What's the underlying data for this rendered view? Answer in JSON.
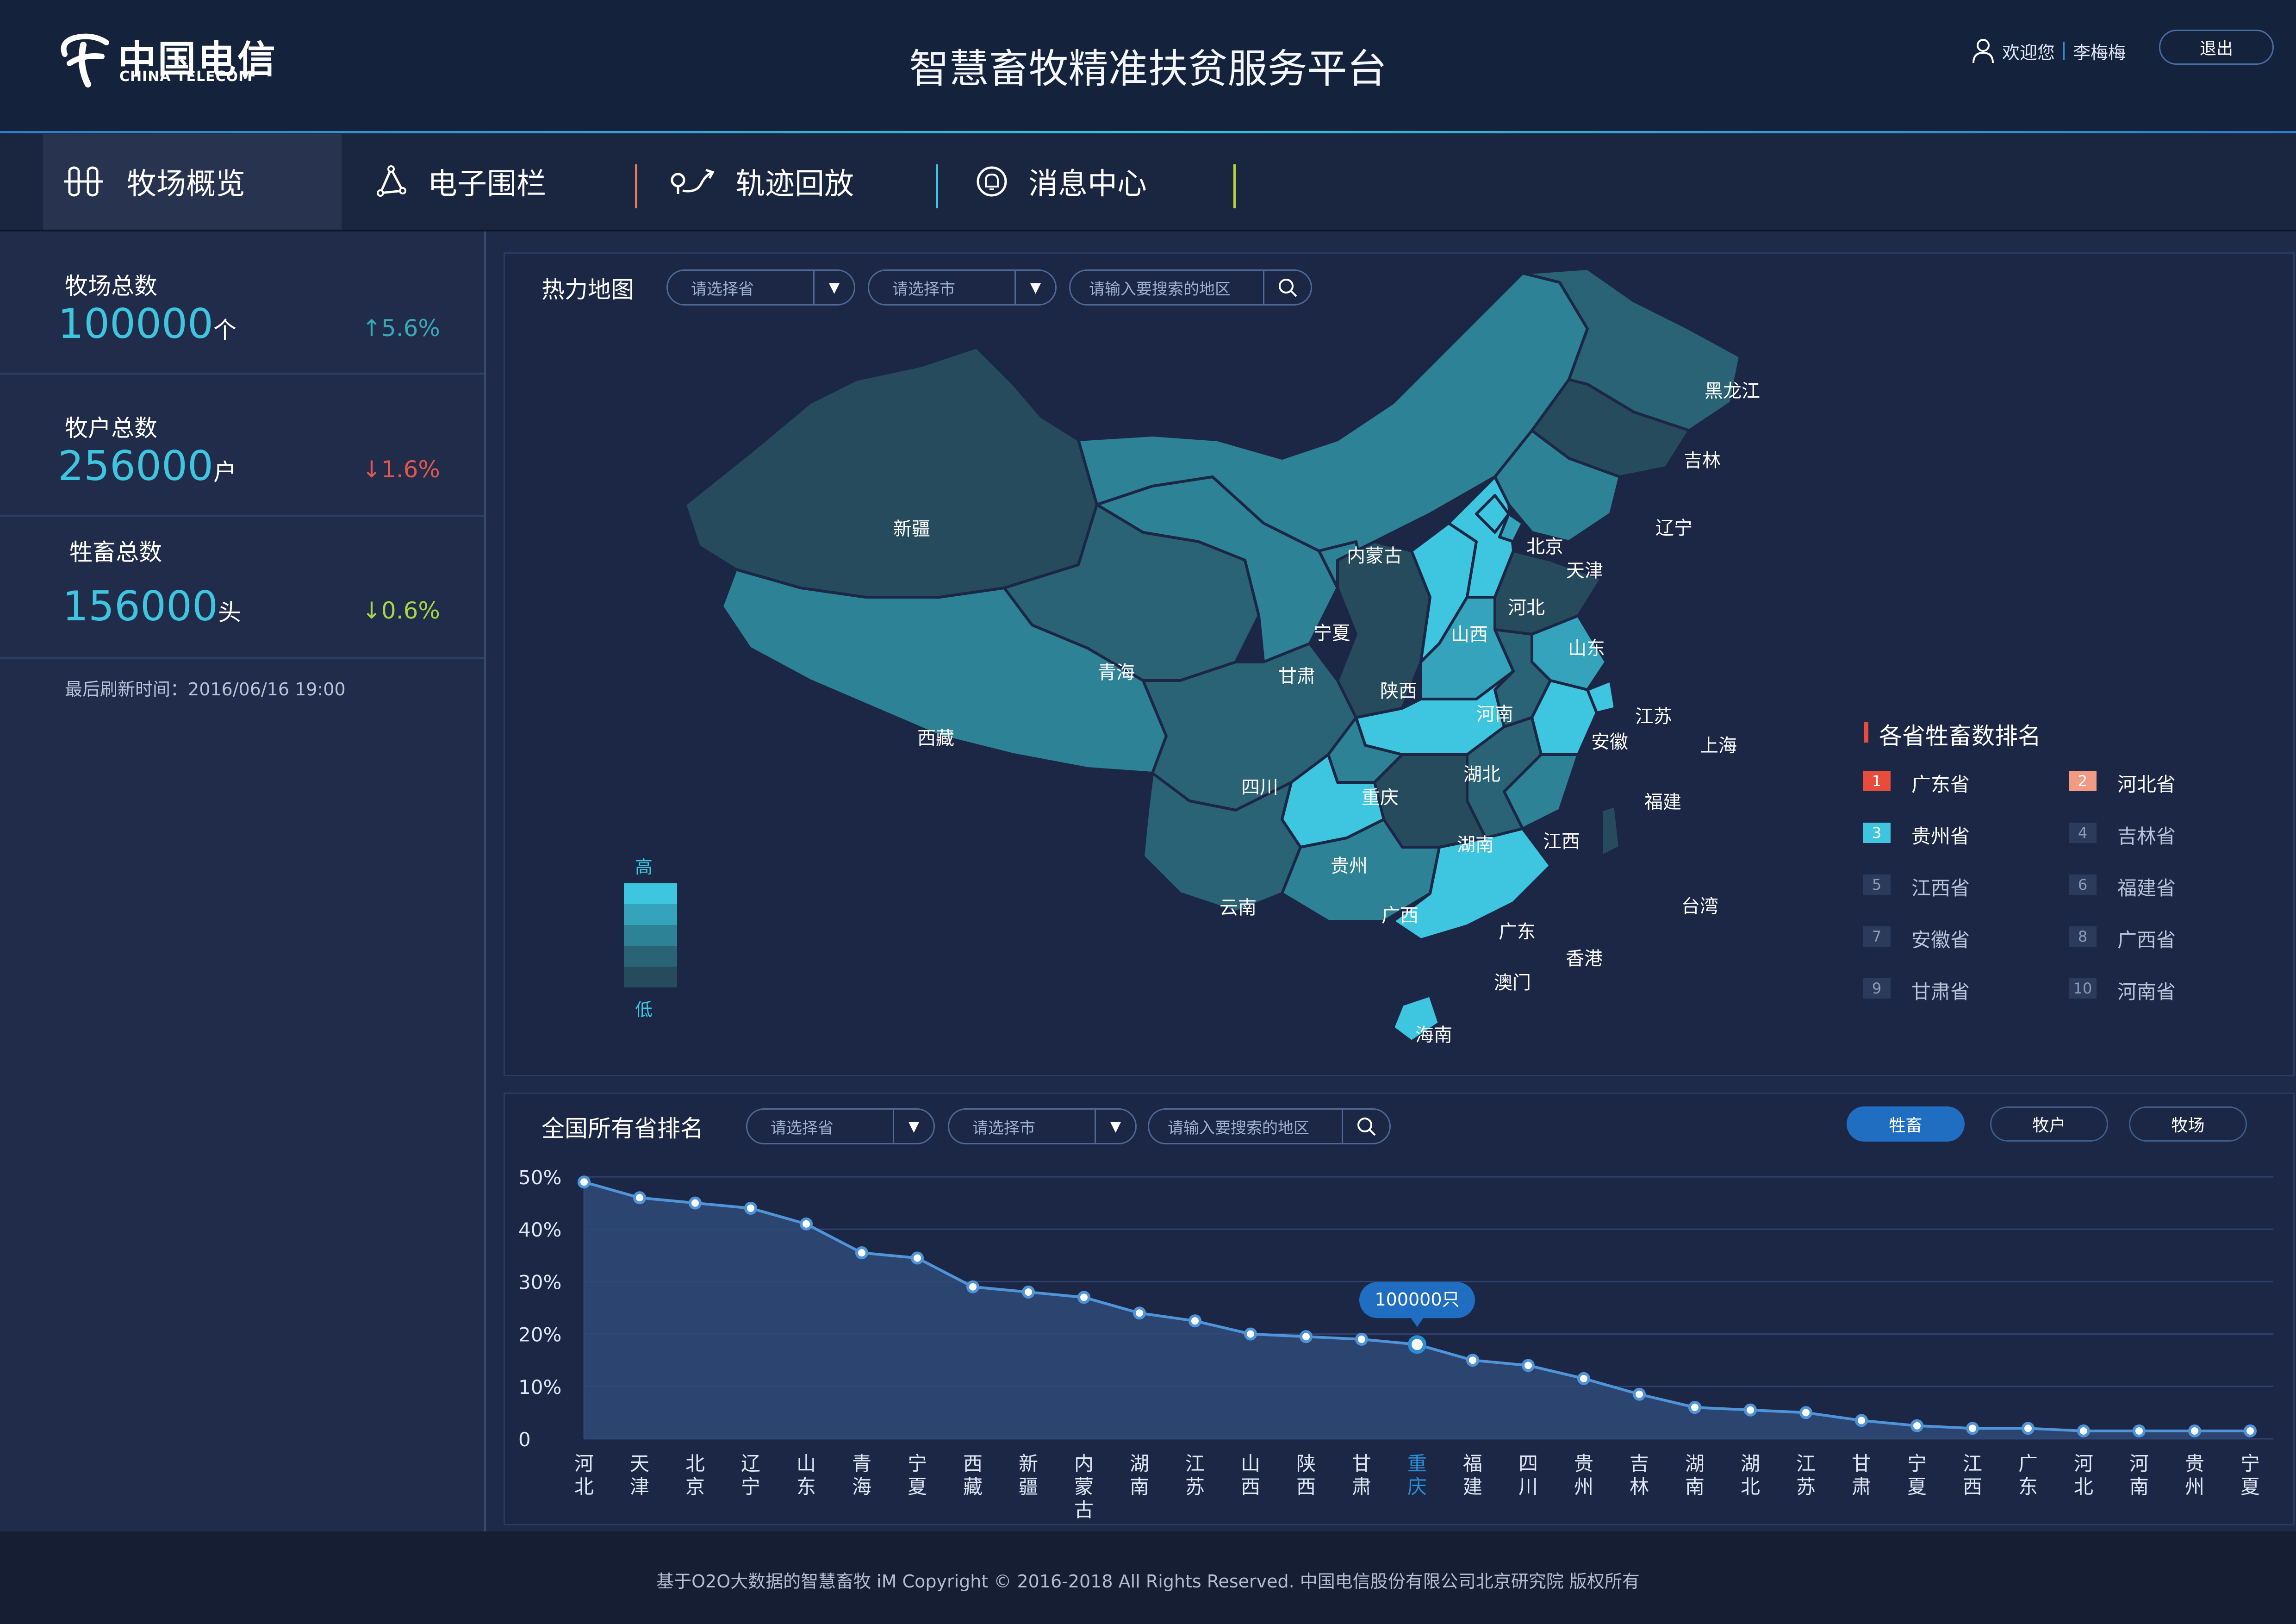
{
  "header": {
    "brand_cn": "中国电信",
    "brand_en": "CHINA TELECOM",
    "title": "智慧畜牧精准扶贫服务平台",
    "welcome": "欢迎您",
    "username": "李梅梅",
    "logout_label": "退出"
  },
  "nav": {
    "items": [
      {
        "label": "牧场概览",
        "icon": "ranch-overview-icon",
        "active": true
      },
      {
        "label": "电子围栏",
        "icon": "geofence-icon"
      },
      {
        "label": "轨迹回放",
        "icon": "track-playback-icon"
      },
      {
        "label": "消息中心",
        "icon": "bell-icon"
      }
    ],
    "separator_colors": [
      "#e8785a",
      "#3ec6e0",
      "#b9d43a"
    ]
  },
  "sidebar": {
    "stats": [
      {
        "label": "牧场总数",
        "value": "100000",
        "unit": "个",
        "change": "↑5.6%",
        "change_color": "#3aa7b8"
      },
      {
        "label": "牧户总数",
        "value": "256000",
        "unit": "户",
        "change": "↓1.6%",
        "change_color": "#e0574f"
      },
      {
        "label": "牲畜总数",
        "value": "156000",
        "unit": "头",
        "change": "↓0.6%",
        "change_color": "#a8d44a"
      }
    ],
    "refresh_label": "最后刷新时间：",
    "refresh_time": "2016/06/16 19:00"
  },
  "map_panel": {
    "title": "热力地图",
    "province_select": "请选择省",
    "city_select": "请选择市",
    "search_placeholder": "请输入要搜索的地区",
    "scale_high": "高",
    "scale_low": "低",
    "scale_colors": [
      "#3ec6e0",
      "#35a3bb",
      "#2e8296",
      "#2a6376",
      "#264b5d"
    ],
    "provinces": [
      "黑龙江",
      "吉林",
      "辽宁",
      "北京",
      "天津",
      "河北",
      "山西",
      "山东",
      "内蒙古",
      "新疆",
      "宁夏",
      "甘肃",
      "青海",
      "陕西",
      "河南",
      "江苏",
      "上海",
      "安徽",
      "西藏",
      "四川",
      "湖北",
      "重庆",
      "福建",
      "湖南",
      "江西",
      "贵州",
      "云南",
      "广西",
      "广东",
      "台湾",
      "香港",
      "澳门",
      "海南"
    ],
    "legend_title": "各省牲畜数排名",
    "ranking": [
      {
        "rank": "1",
        "name": "广东省",
        "color": "#e74c3c"
      },
      {
        "rank": "2",
        "name": "河北省",
        "color": "#f19a84"
      },
      {
        "rank": "3",
        "name": "贵州省",
        "color": "#3ec6e0"
      },
      {
        "rank": "4",
        "name": "吉林省",
        "color": "#2c3b5c"
      },
      {
        "rank": "5",
        "name": "江西省",
        "color": "#2c3b5c"
      },
      {
        "rank": "6",
        "name": "福建省",
        "color": "#2c3b5c"
      },
      {
        "rank": "7",
        "name": "安徽省",
        "color": "#2c3b5c"
      },
      {
        "rank": "8",
        "name": "广西省",
        "color": "#2c3b5c"
      },
      {
        "rank": "9",
        "name": "甘肃省",
        "color": "#2c3b5c"
      },
      {
        "rank": "10",
        "name": "河南省",
        "color": "#2c3b5c"
      }
    ]
  },
  "chart_panel": {
    "title": "全国所有省排名",
    "province_select": "请选择省",
    "city_select": "请选择市",
    "search_placeholder": "请输入要搜索的地区",
    "tabs": [
      {
        "label": "牲畜",
        "active": true
      },
      {
        "label": "牧户",
        "active": false
      },
      {
        "label": "牧场",
        "active": false
      }
    ],
    "tooltip": "100000只"
  },
  "chart_data": {
    "type": "area",
    "categories": [
      "河北",
      "天津",
      "北京",
      "辽宁",
      "山东",
      "青海",
      "宁夏",
      "西藏",
      "新疆",
      "内蒙古",
      "湖南",
      "江苏",
      "山西",
      "陕西",
      "甘肃",
      "重庆",
      "福建",
      "四川",
      "贵州",
      "吉林",
      "湖南",
      "湖北",
      "江苏",
      "甘肃",
      "宁夏",
      "江西",
      "广东",
      "河北",
      "河南",
      "贵州",
      "宁夏"
    ],
    "values": [
      49,
      46,
      45,
      44,
      41,
      35.5,
      34.5,
      29,
      28,
      27,
      24,
      22.5,
      20,
      19.5,
      19,
      18,
      15,
      14,
      11.5,
      8.5,
      6,
      5.5,
      5,
      3.5,
      2.5,
      2,
      2,
      1.5,
      1.5,
      1.5,
      1.5
    ],
    "yticks": [
      "50%",
      "40%",
      "30%",
      "20%",
      "10%",
      "0"
    ],
    "ylim": [
      0,
      50
    ],
    "highlight_index": 15,
    "highlight_color": "#2b8fd8",
    "line_color": "#4f93d8"
  },
  "footer": {
    "text": "基于O2O大数据的智慧畜牧 iM Copyright © 2016-2018 All Rights Reserved. 中国电信股份有限公司北京研究院 版权所有"
  }
}
